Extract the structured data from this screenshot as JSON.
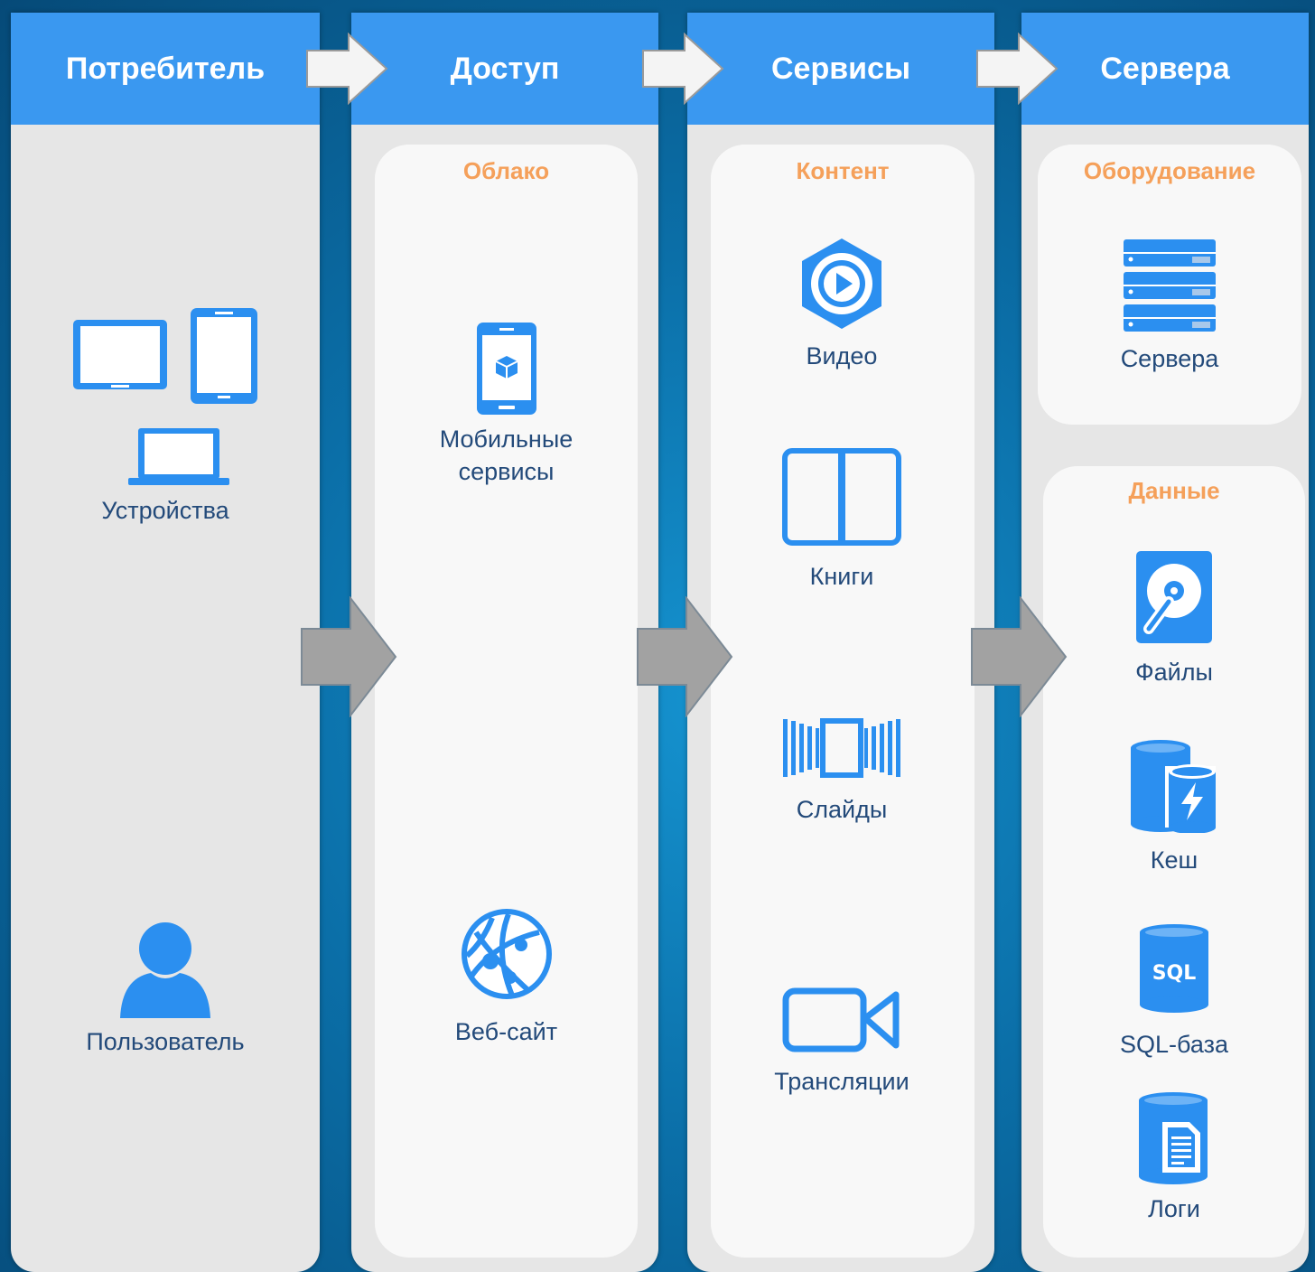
{
  "columns": [
    {
      "title": "Потребитель"
    },
    {
      "title": "Доступ",
      "group": "Облако"
    },
    {
      "title": "Сервисы",
      "group": "Контент"
    },
    {
      "title": "Сервера",
      "groups": [
        "Оборудование",
        "Данные"
      ]
    }
  ],
  "consumer": {
    "devices": "Устройства",
    "user": "Пользователь"
  },
  "access": {
    "mobile_line1": "Мобильные",
    "mobile_line2": "сервисы",
    "website": "Веб-сайт"
  },
  "services": {
    "video": "Видео",
    "books": "Книги",
    "slides": "Слайды",
    "streams": "Трансляции"
  },
  "servers": {
    "servers": "Сервера",
    "files": "Файлы",
    "cache": "Кеш",
    "sql": "SQL-база",
    "logs": "Логи",
    "sql_badge": "SQL"
  },
  "colors": {
    "header": "#3a98f0",
    "icon": "#2b8ff0",
    "group_title": "#f5a05a",
    "label": "#234a7a",
    "panel": "#e6e6e6",
    "arrow_gray": "#a0a0a0"
  }
}
